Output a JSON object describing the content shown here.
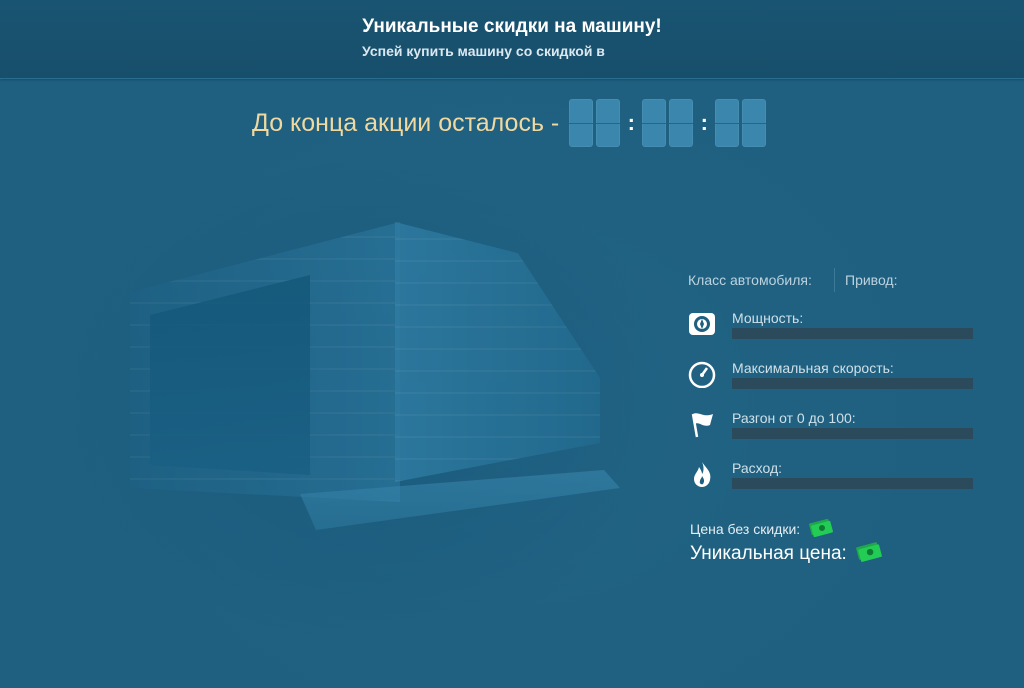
{
  "header": {
    "title": "Уникальные скидки на машину!",
    "subtitle": "Успей купить машину со скидкой в"
  },
  "countdown": {
    "label": "До конца акции осталось -",
    "separator_1": ":",
    "separator_2": ":"
  },
  "specs": {
    "class_label": "Класс автомобиля:",
    "drive_label": "Привод:",
    "rows": [
      {
        "label": "Мощность:",
        "icon": "turbo-icon"
      },
      {
        "label": "Максимальная скорость:",
        "icon": "speedometer-icon"
      },
      {
        "label": "Разгон от 0 до 100:",
        "icon": "flag-icon"
      },
      {
        "label": "Расход:",
        "icon": "flame-icon"
      }
    ]
  },
  "price": {
    "old_label": "Цена без скидки:",
    "new_label": "Уникальная цена:",
    "currency_icon": "money-icon"
  },
  "colors": {
    "background": "#1f5f7f",
    "header": "#195472",
    "countdown_label": "#f0d9a0",
    "digit": "#3a86ad",
    "bar": "#2b4a5c",
    "money": "#22cc55"
  }
}
